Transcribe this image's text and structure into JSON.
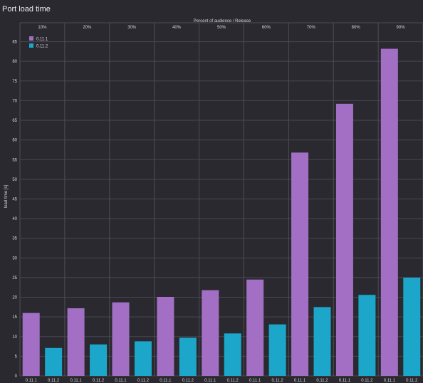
{
  "page": {
    "title": "Port load time"
  },
  "chart_data": {
    "type": "bar",
    "title": "Port load time",
    "facet_label": "Percent of audience / Release",
    "ylabel": "load time [s]",
    "ylim": [
      0,
      88
    ],
    "yticks": [
      0,
      5,
      10,
      15,
      20,
      25,
      30,
      35,
      40,
      45,
      50,
      55,
      60,
      65,
      70,
      75,
      80,
      85
    ],
    "grid": true,
    "legend_position": "top-left",
    "facets": [
      "10%",
      "20%",
      "30%",
      "40%",
      "50%",
      "60%",
      "70%",
      "80%",
      "90%"
    ],
    "categories": [
      "0.11.1",
      "0.11.2"
    ],
    "series": [
      {
        "name": "0.11.1",
        "color": "#a26fc4",
        "values": [
          16.0,
          17.2,
          18.7,
          20.1,
          21.8,
          24.5,
          56.8,
          69.2,
          83.2
        ]
      },
      {
        "name": "0.11.2",
        "color": "#1ca6c9",
        "values": [
          7.1,
          8.0,
          8.8,
          9.7,
          10.8,
          13.1,
          17.5,
          20.6,
          25.0
        ]
      }
    ]
  }
}
